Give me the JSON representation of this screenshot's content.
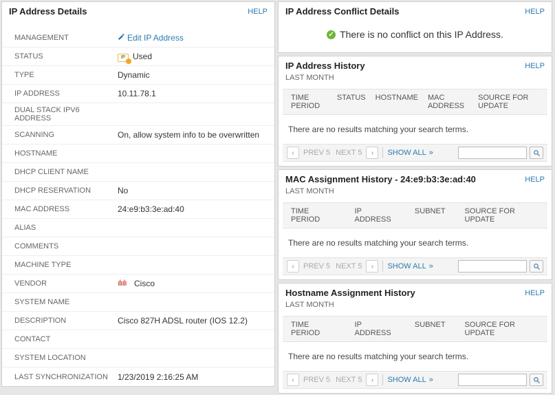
{
  "left": {
    "title": "IP Address Details",
    "help": "HELP",
    "edit_label": "Edit IP Address",
    "rows": {
      "management": "MANAGEMENT",
      "status": "STATUS",
      "status_v": "Used",
      "type": "TYPE",
      "type_v": "Dynamic",
      "ip": "IP ADDRESS",
      "ip_v": "10.11.78.1",
      "dual": "DUAL STACK IPV6 ADDRESS",
      "scanning": "SCANNING",
      "scanning_v": "On, allow system info to be overwritten",
      "hostname": "HOSTNAME",
      "dhcp_client": "DHCP CLIENT NAME",
      "dhcp_res": "DHCP RESERVATION",
      "dhcp_res_v": "No",
      "mac": "MAC ADDRESS",
      "mac_v": "24:e9:b3:3e:ad:40",
      "alias": "ALIAS",
      "comments": "COMMENTS",
      "machine": "MACHINE TYPE",
      "vendor": "VENDOR",
      "vendor_v": "Cisco",
      "sysname": "SYSTEM NAME",
      "desc": "DESCRIPTION",
      "desc_v": "Cisco 827H ADSL router (IOS 12.2)",
      "contact": "CONTACT",
      "syslocation": "SYSTEM LOCATION",
      "lastsync": "LAST SYNCHRONIZATION",
      "lastsync_v": "1/23/2019 2:16:25 AM"
    }
  },
  "conflict": {
    "title": "IP Address Conflict Details",
    "help": "HELP",
    "msg": "There is no conflict on this IP Address."
  },
  "history_common": {
    "help": "HELP",
    "sub": "LAST MONTH",
    "noresults": "There are no results matching your search terms.",
    "prev": "PREV 5",
    "next": "NEXT 5",
    "showall": "SHOW ALL"
  },
  "ip_history": {
    "title": "IP Address History",
    "cols": [
      "TIME PERIOD",
      "STATUS",
      "HOSTNAME",
      "MAC ADDRESS",
      "SOURCE FOR UPDATE"
    ]
  },
  "mac_history": {
    "title": "MAC Assignment History - 24:e9:b3:3e:ad:40",
    "cols": [
      "TIME PERIOD",
      "IP ADDRESS",
      "SUBNET",
      "SOURCE FOR UPDATE"
    ]
  },
  "host_history": {
    "title": "Hostname Assignment History",
    "cols": [
      "TIME PERIOD",
      "IP ADDRESS",
      "SUBNET",
      "SOURCE FOR UPDATE"
    ]
  }
}
